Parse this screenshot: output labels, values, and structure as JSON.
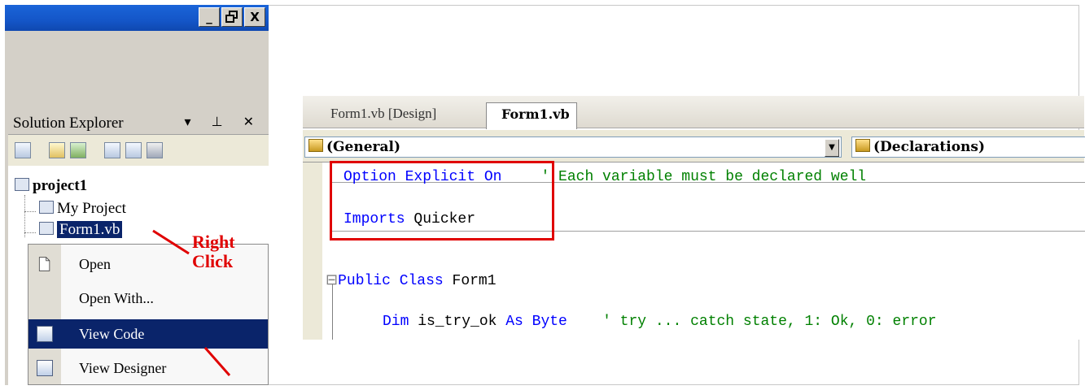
{
  "window": {
    "buttons": [
      "_",
      "̲̅❐",
      "✖"
    ],
    "btn_minimize": "_",
    "btn_restore": "ā",
    "btn_close": "X"
  },
  "solution_explorer": {
    "title": "Solution Explorer",
    "controls": "▾ ⊥ ✕",
    "project": "project1",
    "items": [
      "My Project",
      "Form1.vb"
    ]
  },
  "context_menu": {
    "items": [
      {
        "label": "Open",
        "underline": "O"
      },
      {
        "label": "Open With...",
        "underline": "W"
      },
      {
        "label": "View Code",
        "underline": "C"
      },
      {
        "label": "View Designer",
        "underline": "D"
      }
    ],
    "highlighted": "View Code"
  },
  "annotation": {
    "line1": "Right",
    "line2": "Click",
    "color": "#e00000"
  },
  "editor": {
    "tabs": [
      "Form1.vb [Design]",
      "Form1.vb"
    ],
    "active_tab": "Form1.vb",
    "left_combo": "(General)",
    "right_combo": "(Declarations)",
    "code": {
      "line1_kw": "Option Explicit On",
      "line1_comment": "' Each variable must be declared well",
      "line2_kw": "Imports",
      "line2_rest": " Quicker",
      "line3_fold": "⊟",
      "line3_kw": "Public Class",
      "line3_rest": " Form1",
      "line4_kw1": "Dim",
      "line4_ident": " is_try_ok ",
      "line4_kw2": "As Byte",
      "line4_comment": "    ' try ... catch state, 1: Ok, 0: error"
    }
  },
  "colors": {
    "keyword": "#0000ff",
    "comment": "#008000",
    "highlight": "#0a246a",
    "titlebar": "#1456c8"
  }
}
